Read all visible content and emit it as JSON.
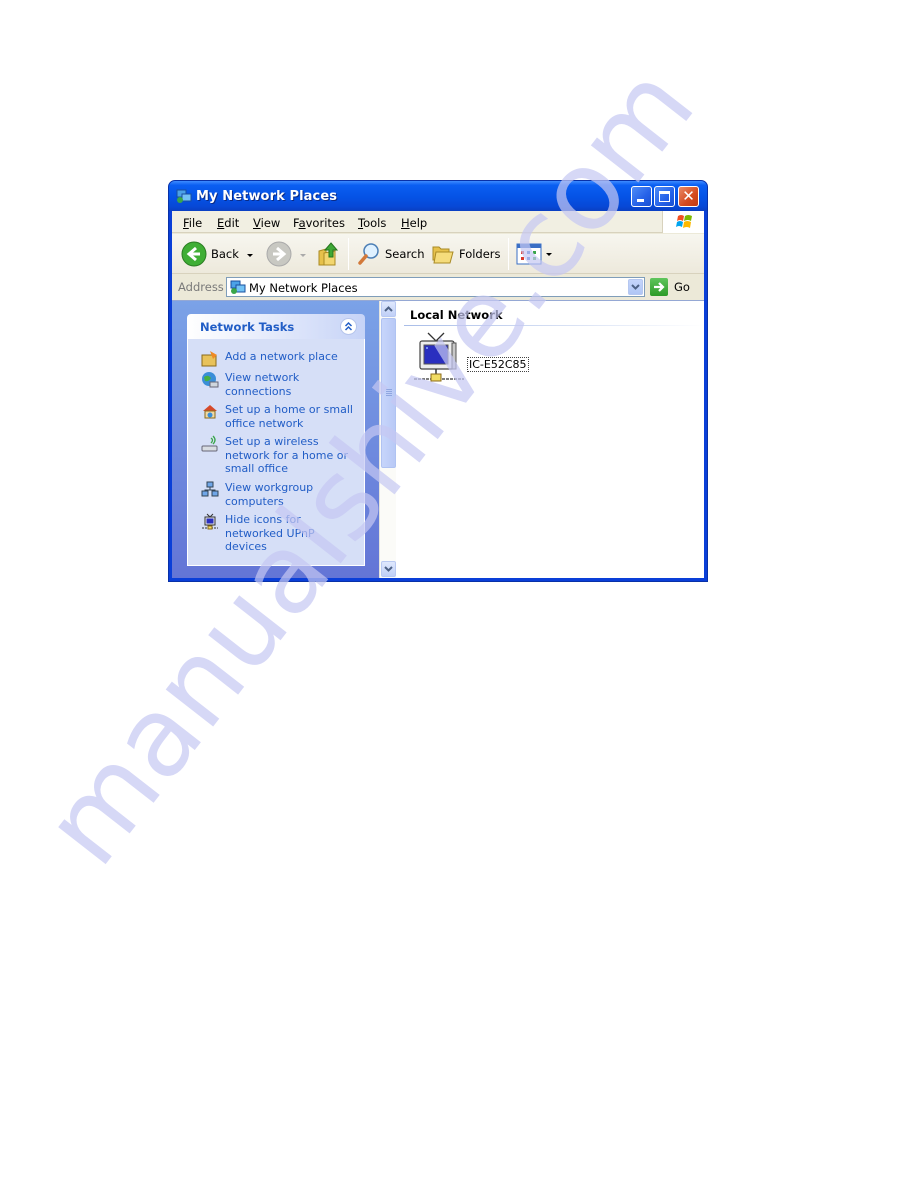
{
  "window": {
    "title": "My Network Places",
    "controls": {
      "minimize": "minimize",
      "maximize": "maximize",
      "close": "close"
    }
  },
  "menubar": {
    "items": [
      {
        "label": "File",
        "accel": "F"
      },
      {
        "label": "Edit",
        "accel": "E"
      },
      {
        "label": "View",
        "accel": "V"
      },
      {
        "label": "Favorites",
        "accel": "a"
      },
      {
        "label": "Tools",
        "accel": "T"
      },
      {
        "label": "Help",
        "accel": "H"
      }
    ]
  },
  "toolbar": {
    "back_label": "Back",
    "search_label": "Search",
    "folders_label": "Folders"
  },
  "addressbar": {
    "label": "Address",
    "value": "My Network Places",
    "go_label": "Go"
  },
  "taskpane": {
    "title": "Network Tasks",
    "items": [
      {
        "label": "Add a network place",
        "icon": "add-network-place-icon"
      },
      {
        "label": "View network connections",
        "icon": "network-connections-icon"
      },
      {
        "label": "Set up a home or small office network",
        "icon": "home-network-icon"
      },
      {
        "label": "Set up a wireless network for a home or small office",
        "icon": "wireless-network-icon"
      },
      {
        "label": "View workgroup computers",
        "icon": "workgroup-computers-icon"
      },
      {
        "label": "Hide icons for networked UPnP devices",
        "icon": "upnp-device-icon"
      }
    ]
  },
  "main": {
    "group_header": "Local Network",
    "devices": [
      {
        "label": "IC-E52C85",
        "icon": "upnp-device-icon"
      }
    ]
  },
  "watermark": "manualshive.com",
  "colors": {
    "title_blue": "#0552e5",
    "task_link": "#215dc6",
    "close_red": "#d44a1f"
  }
}
